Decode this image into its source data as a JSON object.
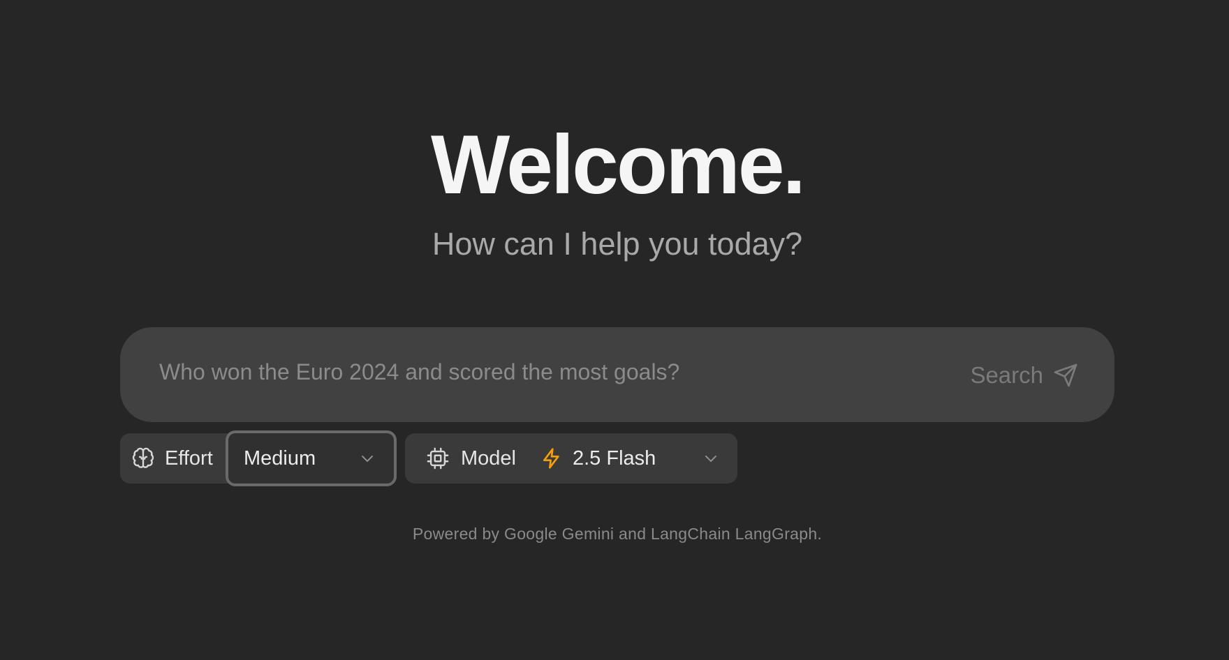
{
  "welcome": {
    "title": "Welcome.",
    "subtitle": "How can I help you today?"
  },
  "search": {
    "placeholder": "Who won the Euro 2024 and scored the most goals?",
    "value": "",
    "button_label": "Search",
    "button_icon": "send-icon"
  },
  "effort": {
    "label": "Effort",
    "icon": "brain-icon",
    "selected": "Medium"
  },
  "model": {
    "label": "Model",
    "icon": "cpu-icon",
    "selected": "2.5 Flash",
    "selected_icon": "lightning-bolt-icon",
    "accent_color": "#f59e0b"
  },
  "footer": {
    "text": "Powered by Google Gemini and LangChain LangGraph."
  },
  "colors": {
    "background": "#262626",
    "input_background": "#414141",
    "control_background": "#3a3a3a"
  }
}
